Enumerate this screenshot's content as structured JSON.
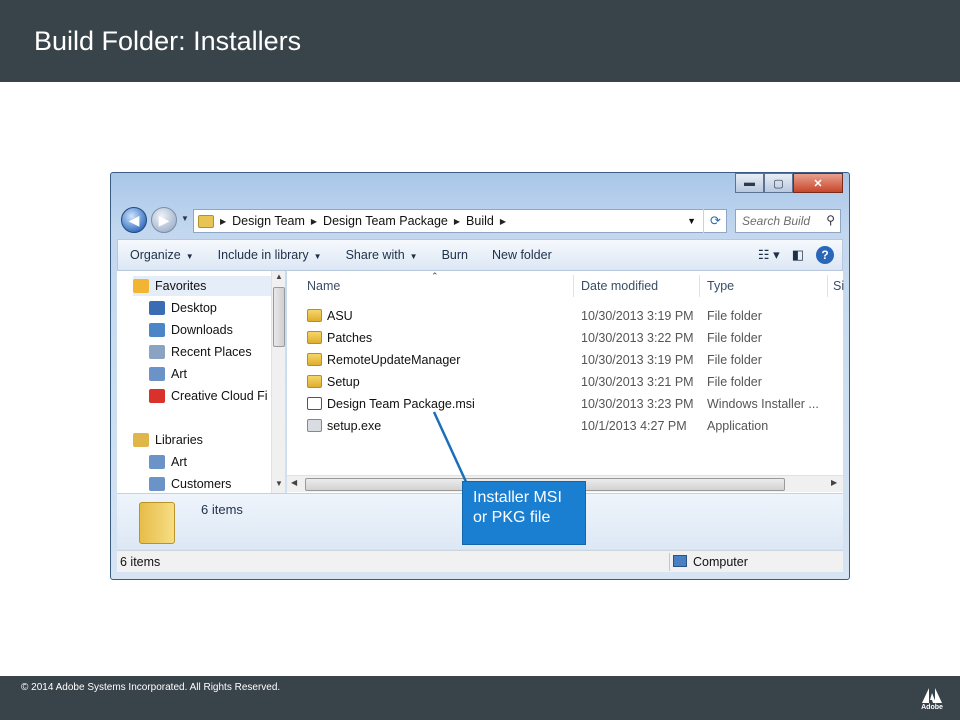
{
  "slide": {
    "title": "Build Folder: Installers",
    "footer": "© 2014 Adobe Systems Incorporated.  All Rights Reserved.",
    "logo_word": "Adobe"
  },
  "window": {
    "caption_buttons": {
      "minimize": "▬",
      "maximize": "▢",
      "close": "✕"
    },
    "breadcrumb": [
      "Design Team",
      "Design Team Package",
      "Build"
    ],
    "search_placeholder": "Search Build",
    "toolbar": [
      "Organize",
      "Include in library",
      "Share with",
      "Burn",
      "New folder"
    ],
    "nav_pane": [
      {
        "label": "Favorites",
        "icon": "star-icon",
        "color": "#f2b531",
        "indent": 0
      },
      {
        "label": "Desktop",
        "icon": "desktop-icon",
        "color": "#3a6db3",
        "indent": 1
      },
      {
        "label": "Downloads",
        "icon": "downloads-icon",
        "color": "#4a86c8",
        "indent": 1
      },
      {
        "label": "Recent Places",
        "icon": "recent-places-icon",
        "color": "#8aa3c2",
        "indent": 1
      },
      {
        "label": "Art",
        "icon": "library-icon",
        "color": "#6c93c7",
        "indent": 1
      },
      {
        "label": "Creative Cloud Fi",
        "icon": "creative-cloud-icon",
        "color": "#d8322a",
        "indent": 1
      },
      {
        "label": "Libraries",
        "icon": "libraries-icon",
        "color": "#e0b64a",
        "indent": 0
      },
      {
        "label": "Art",
        "icon": "library-icon",
        "color": "#6c93c7",
        "indent": 1
      },
      {
        "label": "Customers",
        "icon": "library-icon",
        "color": "#6c93c7",
        "indent": 1
      }
    ],
    "columns": {
      "name": "Name",
      "date": "Date modified",
      "type": "Type",
      "size": "Si"
    },
    "files": [
      {
        "name": "ASU",
        "date": "10/30/2013 3:19 PM",
        "type": "File folder",
        "kind": "folder"
      },
      {
        "name": "Patches",
        "date": "10/30/2013 3:22 PM",
        "type": "File folder",
        "kind": "folder"
      },
      {
        "name": "RemoteUpdateManager",
        "date": "10/30/2013 3:19 PM",
        "type": "File folder",
        "kind": "folder"
      },
      {
        "name": "Setup",
        "date": "10/30/2013 3:21 PM",
        "type": "File folder",
        "kind": "folder"
      },
      {
        "name": "Design Team Package.msi",
        "date": "10/30/2013 3:23 PM",
        "type": "Windows Installer ...",
        "kind": "msi"
      },
      {
        "name": "setup.exe",
        "date": "10/1/2013 4:27 PM",
        "type": "Application",
        "kind": "exe"
      }
    ],
    "details_count": "6 items",
    "status_left": "6 items",
    "status_right": "Computer"
  },
  "callout": {
    "text": "Installer MSI or PKG file",
    "color": "#1b7fd1"
  }
}
